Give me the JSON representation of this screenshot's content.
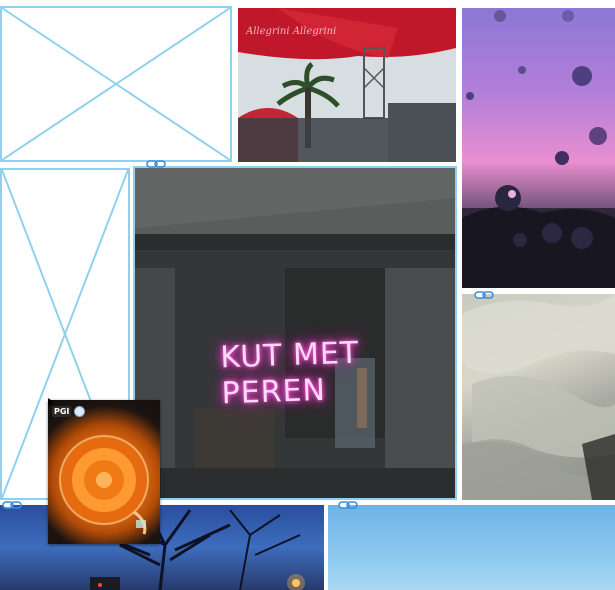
{
  "canvas": {
    "background": "#ffffff",
    "frame_border_color": "#8fd0ee"
  },
  "frames": [
    {
      "id": "empty-frame-top-left",
      "kind": "placeholder"
    },
    {
      "id": "umbrella-photo",
      "kind": "image",
      "subject": "red patio umbrellas with palm tree",
      "umbrella_print": "Allegrini Allegrini"
    },
    {
      "id": "raindrops-photo",
      "kind": "image",
      "subject": "raindrops on glass against pink sky"
    },
    {
      "id": "empty-frame-left",
      "kind": "placeholder"
    },
    {
      "id": "neon-photo",
      "kind": "image",
      "subject": "neon sign in window",
      "neon_text": "KUT MET\nPEREN",
      "selected": true
    },
    {
      "id": "fabric-photo",
      "kind": "image",
      "subject": "sheer fabric"
    },
    {
      "id": "dusk-photo",
      "kind": "image",
      "subject": "tree silhouette at dusk with street lights"
    },
    {
      "id": "sky-photo",
      "kind": "image",
      "subject": "clear blue sky"
    }
  ],
  "floating_thumbnail": {
    "subject": "cup of tea from above",
    "badge_text": "PGI"
  },
  "icons": {
    "link": "link-chain-icon",
    "triangle": "play-triangle-icon"
  }
}
